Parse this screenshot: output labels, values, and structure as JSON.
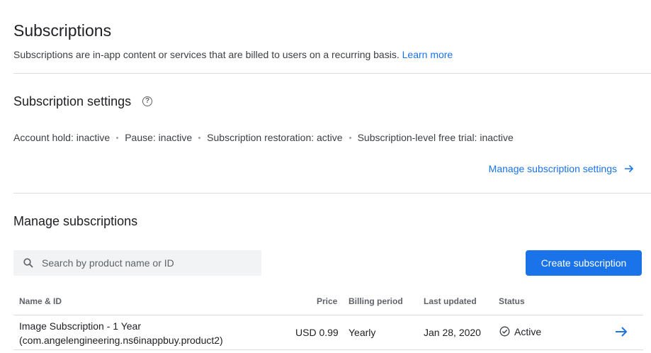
{
  "header": {
    "title": "Subscriptions",
    "description": "Subscriptions are in-app content or services that are billed to users on a recurring basis.",
    "learn_more": "Learn more"
  },
  "settings": {
    "title": "Subscription settings",
    "help_icon": "help-circle-icon",
    "items": [
      "Account hold: inactive",
      "Pause: inactive",
      "Subscription restoration: active",
      "Subscription-level free trial: inactive"
    ],
    "manage_link": "Manage subscription settings",
    "manage_link_icon": "arrow-right-icon"
  },
  "manage": {
    "title": "Manage subscriptions",
    "search": {
      "placeholder": "Search by product name or ID",
      "value": "",
      "icon": "search-icon"
    },
    "create_button": "Create subscription",
    "table": {
      "headers": {
        "name": "Name & ID",
        "price": "Price",
        "billing": "Billing period",
        "updated": "Last updated",
        "status": "Status"
      },
      "rows": [
        {
          "name": "Image Subscription - 1 Year",
          "id": "(com.angelengineering.ns6inappbuy.product2)",
          "price": "USD 0.99",
          "billing": "Yearly",
          "updated": "Jan 28, 2020",
          "status": "Active",
          "status_icon": "check-circle-icon",
          "action_icon": "arrow-right-icon"
        }
      ]
    }
  },
  "colors": {
    "accent": "#1a73e8",
    "divider": "#dadce0",
    "text_primary": "#202124",
    "text_secondary": "#5f6368"
  }
}
